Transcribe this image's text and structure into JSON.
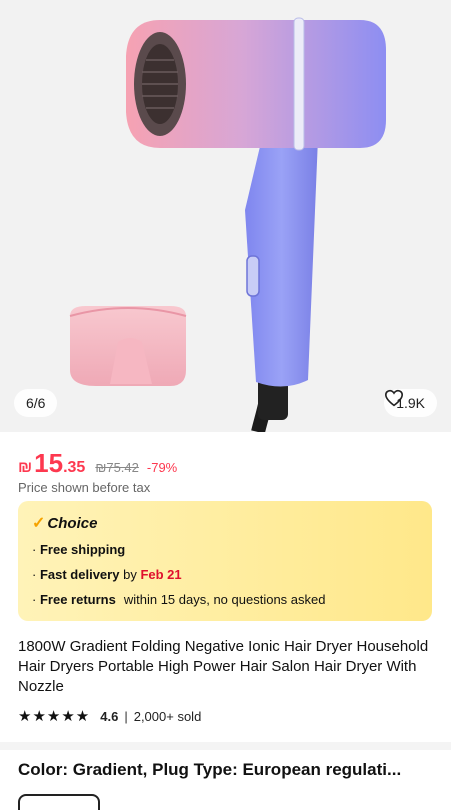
{
  "gallery": {
    "counter": "6/6",
    "wishlist_count": "1.9K",
    "icon": "heart-icon"
  },
  "price": {
    "currency": "₪",
    "integer": "15",
    "decimal": ".35",
    "original": "₪75.42",
    "discount": "-79%",
    "note": "Price shown before tax"
  },
  "choice": {
    "title": "Choice",
    "lines": [
      {
        "bullet": "·",
        "label": "Free shipping"
      },
      {
        "bullet": "·",
        "label": "Fast delivery",
        "by": "by",
        "date": "Feb 21"
      },
      {
        "bullet": "·",
        "label": "Free returns",
        "detail": "within 15 days, no questions asked"
      }
    ]
  },
  "product": {
    "title": "1800W Gradient Folding Negative Ionic Hair Dryer Household Hair Dryers Portable High Power Hair Salon Hair Dryer With Nozzle",
    "stars": "★★★★★",
    "rating": "4.6",
    "separator": "|",
    "sold": "2,000+ sold"
  },
  "options": {
    "label": "Color: Gradient, Plug Type: European regulati..."
  },
  "colors": {
    "accent": "#fd384f",
    "choice_bg": "#ffe88a",
    "dryer_pink": "#f7a7b6",
    "dryer_blue": "#8f8ff0"
  }
}
